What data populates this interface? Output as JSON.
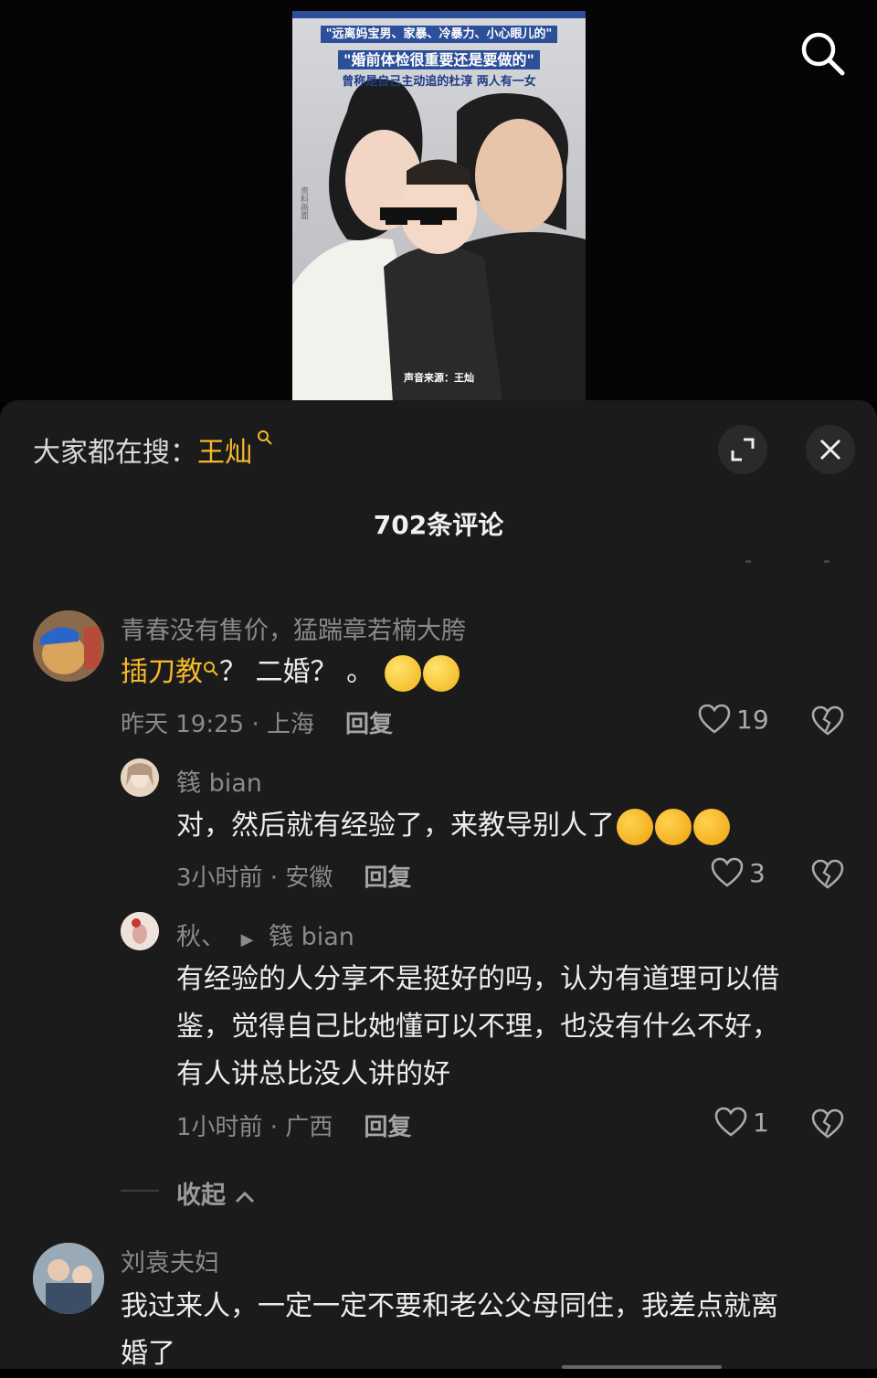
{
  "video": {
    "caption1": "\"远离妈宝男、家暴、冷暴力、小心眼儿的\"",
    "caption2": "\"婚前体检很重要还是要做的\"",
    "caption3": "曾称是自己主动追的杜淳 两人有一女",
    "credit": "声音来源：王灿",
    "side_text": "资料画面"
  },
  "sheet": {
    "hot_prefix": "大家都在搜：",
    "hot_keyword": "王灿",
    "comment_count": "702条评论"
  },
  "comments": [
    {
      "user": "青春没有售价，猛踹章若楠大胯",
      "text_link": "插刀教",
      "text_rest": "？ 二婚？ 。",
      "meta": "昨天 19:25 · 上海",
      "reply": "回复",
      "likes": "19"
    },
    {
      "user": "篯 bian",
      "text": "对，然后就有经验了，来教导别人了",
      "meta": "3小时前 · 安徽",
      "reply": "回复",
      "likes": "3"
    },
    {
      "user": "秋、",
      "reply_to": "篯 bian",
      "text_lines": [
        "有经验的人分享不是挺好的吗，认为有道理可以借",
        "鉴，觉得自己比她懂可以不理，也没有什么不好，",
        "有人讲总比没人讲的好"
      ],
      "meta": "1小时前 · 广西",
      "reply": "回复",
      "likes": "1"
    },
    {
      "user": "刘袁夫妇",
      "text_lines": [
        "我过来人，一定一定不要和老公父母同住，我差点就离",
        "婚了"
      ]
    }
  ],
  "collapse_label": "收起",
  "icons": {
    "search": "search-icon",
    "expand": "expand-icon",
    "close": "close-icon",
    "like": "heart-icon",
    "dislike": "broken-heart-icon"
  },
  "colors": {
    "accent": "#f5b92a",
    "sheet_bg": "#1b1b1b"
  }
}
